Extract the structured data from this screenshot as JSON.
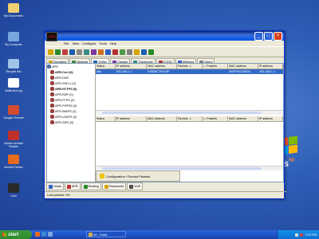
{
  "desktop": {
    "icons": [
      {
        "label": "My Documents",
        "icon": "folder-icon",
        "color": "#f0d070"
      },
      {
        "label": "My Computer",
        "icon": "computer-icon",
        "color": "#7aa6e0"
      },
      {
        "label": "Recycle Bin",
        "icon": "recycle-bin-icon",
        "color": "#9fc4e8"
      },
      {
        "label": "Bellal.text.log",
        "icon": "text-file-icon",
        "color": "#ffffff"
      },
      {
        "label": "Google Chrome",
        "icon": "chrome-icon",
        "color": "#d44b2f"
      },
      {
        "label": "Adobe Acrobat Reader",
        "icon": "acrobat-icon",
        "color": "#c0302a"
      },
      {
        "label": "Mozilla Firefox",
        "icon": "firefox-icon",
        "color": "#e66b1f"
      },
      {
        "label": "Cain",
        "icon": "cain-icon",
        "color": "#2a2a2a"
      }
    ],
    "xp_logo": "ws",
    "xp_sup": "xp"
  },
  "window": {
    "app_icon_text": "C&A",
    "menu": [
      "File",
      "View",
      "Configure",
      "Tools",
      "Help"
    ],
    "tabs": [
      {
        "label": "Decoders",
        "icon": "key-icon",
        "color": "#d6a400"
      },
      {
        "label": "Network",
        "icon": "network-icon",
        "color": "#3a8a3a"
      },
      {
        "label": "Sniffer",
        "icon": "sniffer-icon",
        "color": "#1a5fb0",
        "active": true
      },
      {
        "label": "Cracker",
        "icon": "cracker-icon",
        "color": "#7a3aa0"
      },
      {
        "label": "Traceroute",
        "icon": "traceroute-icon",
        "color": "#2a8a8a"
      },
      {
        "label": "CCDU",
        "icon": "ccdu-icon",
        "color": "#b03030"
      },
      {
        "label": "Wireless",
        "icon": "wireless-icon",
        "color": "#3060c0"
      },
      {
        "label": "Query",
        "icon": "query-icon",
        "color": "#808080"
      }
    ],
    "tree": {
      "root": "APR",
      "items": [
        {
          "label": "APR-Cert (0)",
          "bold": true
        },
        {
          "label": "APR-DNS",
          "bold": false
        },
        {
          "label": "APR-SSH-1 (0)",
          "bold": false
        },
        {
          "label": "APR-HTTPS (0)",
          "bold": true
        },
        {
          "label": "APR-RDP (0)",
          "bold": false
        },
        {
          "label": "APR-FTPS (0)",
          "bold": false
        },
        {
          "label": "APR-POP3S (0)",
          "bold": false
        },
        {
          "label": "APR-IMAPS (0)",
          "bold": false
        },
        {
          "label": "APR-LDAPS (0)",
          "bold": false
        },
        {
          "label": "APR-SIPS (0)",
          "bold": false
        }
      ]
    },
    "grid1": {
      "headers": [
        "Status",
        "IP address",
        "MAC address",
        "Packets ->",
        "<- Packets",
        "MAC address",
        "IP address"
      ],
      "rows": [
        [
          "Idle",
          "192.168.1.1",
          "0080BC7FAC9F",
          "",
          "",
          "00DF967250D0",
          "192.168.1.1"
        ]
      ]
    },
    "grid2": {
      "headers": [
        "Status",
        "IP address",
        "MAC address",
        "Packets ->",
        "<- Packets",
        "MAC address",
        "IP address"
      ]
    },
    "config_button": "Configuration / Routed Packets",
    "bottom_tabs": [
      {
        "label": "Hosts",
        "icon": "hosts-icon",
        "color": "#3060c0"
      },
      {
        "label": "APR",
        "icon": "apr-icon",
        "color": "#c03030"
      },
      {
        "label": "Routing",
        "icon": "routing-icon",
        "color": "#2a8a2a"
      },
      {
        "label": "Passwords",
        "icon": "passwords-icon",
        "color": "#d6a400"
      },
      {
        "label": "VoIP",
        "icon": "voip-icon",
        "color": "#4a4a4a"
      }
    ],
    "status": "Lost packets:  0%"
  },
  "taskbar": {
    "start_label": "start",
    "task_label": "34 - Paint",
    "clock": "7:20 PM"
  }
}
